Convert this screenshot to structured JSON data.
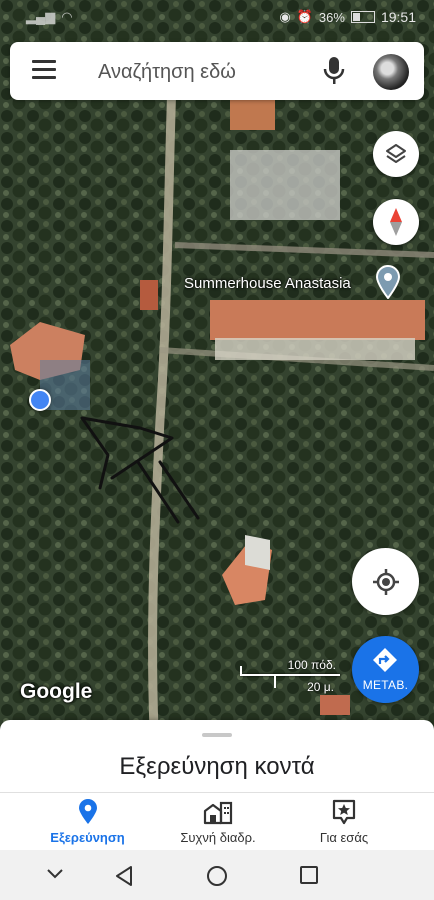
{
  "status_bar": {
    "time": "19:51",
    "battery": "36%"
  },
  "search": {
    "placeholder": "Αναζήτηση εδώ"
  },
  "map": {
    "place_label": "Summerhouse Anastasia",
    "logo": "Google",
    "scale_feet": "100 πόδ.",
    "scale_meters": "20 μ."
  },
  "go_button": {
    "label": "ΜΕΤΑΒ."
  },
  "sheet": {
    "title": "Εξερεύνηση κοντά"
  },
  "bottom_nav": {
    "tabs": [
      {
        "label": "Εξερεύνηση",
        "icon": "place-pin-icon",
        "active": true
      },
      {
        "label": "Συχνή διαδρ.",
        "icon": "commute-building-icon",
        "active": false
      },
      {
        "label": "Για εσάς",
        "icon": "for-you-star-icon",
        "active": false
      }
    ]
  },
  "colors": {
    "accent": "#1a73e8",
    "location_dot": "#4285f4",
    "compass_red": "#ea4335"
  }
}
